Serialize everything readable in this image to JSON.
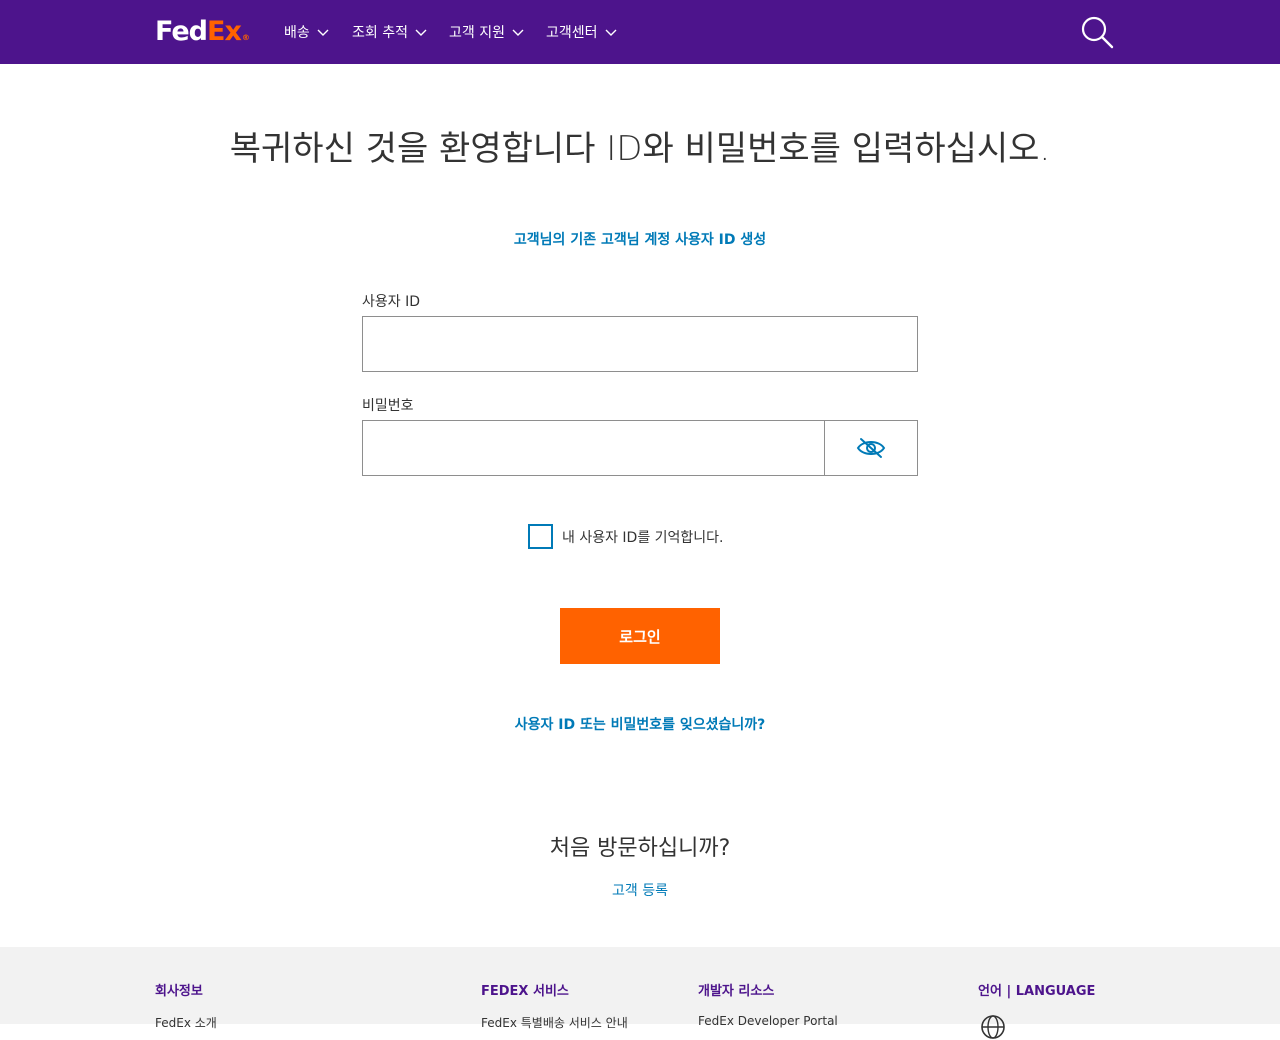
{
  "header": {
    "logo_fed": "Fed",
    "logo_ex": "Ex",
    "logo_reg": "®",
    "nav": [
      {
        "label": "배송"
      },
      {
        "label": "조회 추적"
      },
      {
        "label": "고객 지원"
      },
      {
        "label": "고객센터"
      }
    ]
  },
  "main": {
    "title": "복귀하신 것을 환영합니다 ID와 비밀번호를 입력하십시오.",
    "create_link": "고객님의 기존 고객님 계정 사용자 ID 생성",
    "user_id_label": "사용자 ID",
    "user_id_value": "",
    "password_label": "비밀번호",
    "password_value": "",
    "remember_label": "내 사용자 ID를 기억합니다.",
    "login_button": "로그인",
    "forgot_link": "사용자 ID 또는 비밀번호를 잊으셨습니까?",
    "new_user_title": "처음 방문하십니까?",
    "signup_link": "고객 등록"
  },
  "footer": {
    "columns": [
      {
        "title": "회사정보",
        "link": "FedEx 소개"
      },
      {
        "title": "FEDEX 서비스",
        "link": "FedEx 특별배송 서비스 안내"
      },
      {
        "title": "개발자 리소스",
        "link": "FedEx Developer Portal"
      },
      {
        "title": "언어 | LANGUAGE",
        "link": ""
      }
    ]
  },
  "colors": {
    "brand_purple": "#4d148c",
    "brand_orange": "#ff6200",
    "link_blue": "#007ab7"
  },
  "icons": {
    "nav_chevron": "chevron-down-icon",
    "search": "search-icon",
    "password_toggle": "eye-slash-icon",
    "language": "globe-icon"
  }
}
